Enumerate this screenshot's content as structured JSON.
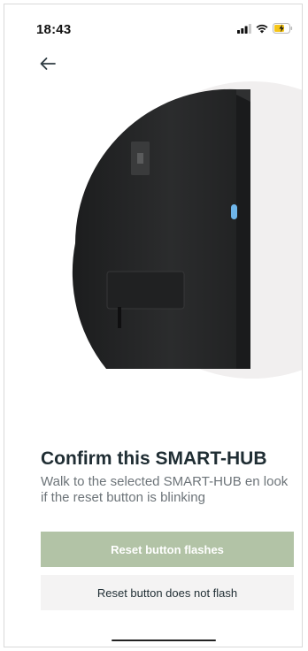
{
  "status_bar": {
    "time": "18:43",
    "icons": [
      "signal-icon",
      "wifi-icon",
      "battery-charging-icon"
    ]
  },
  "nav": {
    "back_icon": "arrow-left-icon"
  },
  "hero": {
    "device_image": "smart-hub-device",
    "indicator_color": "#6fb6ea"
  },
  "content": {
    "title": "Confirm this SMART-HUB",
    "subtitle": "Walk to the selected SMART-HUB en look if the reset button is blinking"
  },
  "actions": {
    "primary_label": "Reset button flashes",
    "secondary_label": "Reset button does not flash"
  },
  "colors": {
    "primary_button": "#b2c3a6",
    "secondary_button": "#f4f3f3",
    "title_text": "#1f2d33"
  }
}
